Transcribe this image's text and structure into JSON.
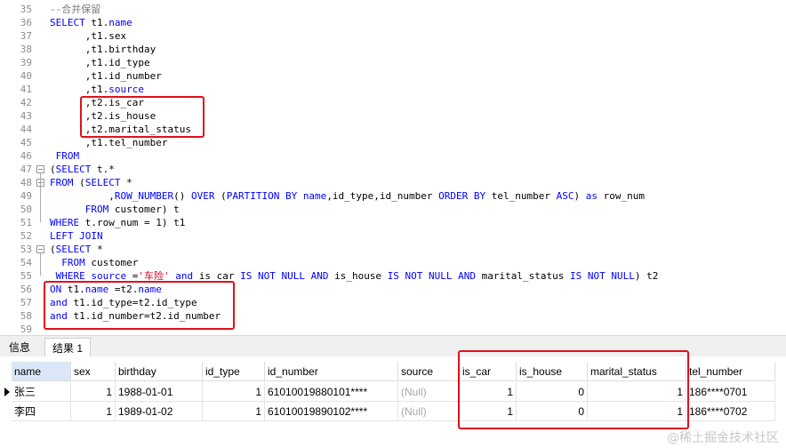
{
  "editor": {
    "lines": [
      {
        "n": "35",
        "tokens": [
          {
            "t": "--合并保留",
            "c": "cm"
          }
        ]
      },
      {
        "n": "36",
        "tokens": [
          {
            "t": "SELECT ",
            "c": "kw"
          },
          {
            "t": "t1.",
            "c": ""
          },
          {
            "t": "name",
            "c": "kw"
          }
        ]
      },
      {
        "n": "37",
        "tokens": [
          {
            "t": "      ,t1.sex",
            "c": ""
          }
        ]
      },
      {
        "n": "38",
        "tokens": [
          {
            "t": "      ,t1.birthday",
            "c": ""
          }
        ]
      },
      {
        "n": "39",
        "tokens": [
          {
            "t": "      ,t1.id_type",
            "c": ""
          }
        ]
      },
      {
        "n": "40",
        "tokens": [
          {
            "t": "      ,t1.id_number",
            "c": ""
          }
        ]
      },
      {
        "n": "41",
        "tokens": [
          {
            "t": "      ,t1.",
            "c": ""
          },
          {
            "t": "source",
            "c": "kw"
          }
        ]
      },
      {
        "n": "42",
        "tokens": [
          {
            "t": "      ,t2.is_car",
            "c": ""
          }
        ]
      },
      {
        "n": "43",
        "tokens": [
          {
            "t": "      ,t2.is_house",
            "c": ""
          }
        ]
      },
      {
        "n": "44",
        "tokens": [
          {
            "t": "      ,t2.marital_status",
            "c": ""
          }
        ]
      },
      {
        "n": "45",
        "tokens": [
          {
            "t": "      ,t1.tel_number",
            "c": ""
          }
        ]
      },
      {
        "n": "46",
        "tokens": [
          {
            "t": " FROM",
            "c": "kw"
          }
        ]
      },
      {
        "n": "47",
        "tokens": [
          {
            "t": "(",
            "c": ""
          },
          {
            "t": "SELECT ",
            "c": "kw"
          },
          {
            "t": "t.*",
            "c": ""
          }
        ]
      },
      {
        "n": "48",
        "tokens": [
          {
            "t": "FROM ",
            "c": "kw"
          },
          {
            "t": "(",
            "c": ""
          },
          {
            "t": "SELECT ",
            "c": "kw"
          },
          {
            "t": "*",
            "c": ""
          }
        ]
      },
      {
        "n": "49",
        "tokens": [
          {
            "t": "          ,",
            "c": ""
          },
          {
            "t": "ROW_NUMBER",
            "c": "fn"
          },
          {
            "t": "() ",
            "c": ""
          },
          {
            "t": "OVER ",
            "c": "kw"
          },
          {
            "t": "(",
            "c": ""
          },
          {
            "t": "PARTITION BY ",
            "c": "kw"
          },
          {
            "t": "name",
            "c": "kw"
          },
          {
            "t": ",id_type,id_number ",
            "c": ""
          },
          {
            "t": "ORDER BY ",
            "c": "kw"
          },
          {
            "t": "tel_number ",
            "c": ""
          },
          {
            "t": "ASC",
            "c": "kw"
          },
          {
            "t": ") ",
            "c": ""
          },
          {
            "t": "as ",
            "c": "kw"
          },
          {
            "t": "row_num",
            "c": ""
          }
        ]
      },
      {
        "n": "50",
        "tokens": [
          {
            "t": "      ",
            "c": ""
          },
          {
            "t": "FROM ",
            "c": "kw"
          },
          {
            "t": "customer) t",
            "c": ""
          }
        ]
      },
      {
        "n": "51",
        "tokens": [
          {
            "t": "WHERE ",
            "c": "kw"
          },
          {
            "t": "t.row_num = 1) t1",
            "c": ""
          }
        ]
      },
      {
        "n": "52",
        "tokens": [
          {
            "t": "LEFT JOIN",
            "c": "kw"
          }
        ]
      },
      {
        "n": "53",
        "tokens": [
          {
            "t": "(",
            "c": ""
          },
          {
            "t": "SELECT ",
            "c": "kw"
          },
          {
            "t": "*",
            "c": ""
          }
        ]
      },
      {
        "n": "54",
        "tokens": [
          {
            "t": "  ",
            "c": ""
          },
          {
            "t": "FROM ",
            "c": "kw"
          },
          {
            "t": "customer",
            "c": ""
          }
        ]
      },
      {
        "n": "55",
        "tokens": [
          {
            "t": " ",
            "c": ""
          },
          {
            "t": "WHERE ",
            "c": "kw"
          },
          {
            "t": "source",
            "c": "kw"
          },
          {
            "t": " =",
            "c": ""
          },
          {
            "t": "'车险'",
            "c": "str"
          },
          {
            "t": " ",
            "c": ""
          },
          {
            "t": "and ",
            "c": "kw"
          },
          {
            "t": "is_car ",
            "c": ""
          },
          {
            "t": "IS NOT NULL AND ",
            "c": "kw"
          },
          {
            "t": "is_house ",
            "c": ""
          },
          {
            "t": "IS NOT NULL AND ",
            "c": "kw"
          },
          {
            "t": "marital_status ",
            "c": ""
          },
          {
            "t": "IS NOT NULL",
            "c": "kw"
          },
          {
            "t": ") t2",
            "c": ""
          }
        ]
      },
      {
        "n": "56",
        "tokens": [
          {
            "t": "ON ",
            "c": "kw"
          },
          {
            "t": "t1.",
            "c": ""
          },
          {
            "t": "name",
            "c": "kw"
          },
          {
            "t": " =t2.",
            "c": ""
          },
          {
            "t": "name",
            "c": "kw"
          }
        ]
      },
      {
        "n": "57",
        "tokens": [
          {
            "t": "and ",
            "c": "kw"
          },
          {
            "t": "t1.id_type=t2.id_type",
            "c": ""
          }
        ]
      },
      {
        "n": "58",
        "tokens": [
          {
            "t": "and ",
            "c": "kw"
          },
          {
            "t": "t1.id_number=t2.id_number",
            "c": ""
          }
        ]
      },
      {
        "n": "59",
        "tokens": []
      }
    ]
  },
  "tabs": [
    {
      "label": "信息"
    },
    {
      "label": "结果 1"
    }
  ],
  "grid": {
    "columns": [
      "name",
      "sex",
      "birthday",
      "id_type",
      "id_number",
      "source",
      "is_car",
      "is_house",
      "marital_status",
      "tel_number"
    ],
    "rows": [
      [
        "张三",
        "1",
        "1988-01-01",
        "1",
        "61010019880101****",
        "(Null)",
        "1",
        "0",
        "1",
        "186****0701"
      ],
      [
        "李四",
        "1",
        "1989-01-02",
        "1",
        "61010019890102****",
        "(Null)",
        "1",
        "0",
        "1",
        "186****0702"
      ]
    ]
  },
  "watermark": "@稀土掘金技术社区"
}
